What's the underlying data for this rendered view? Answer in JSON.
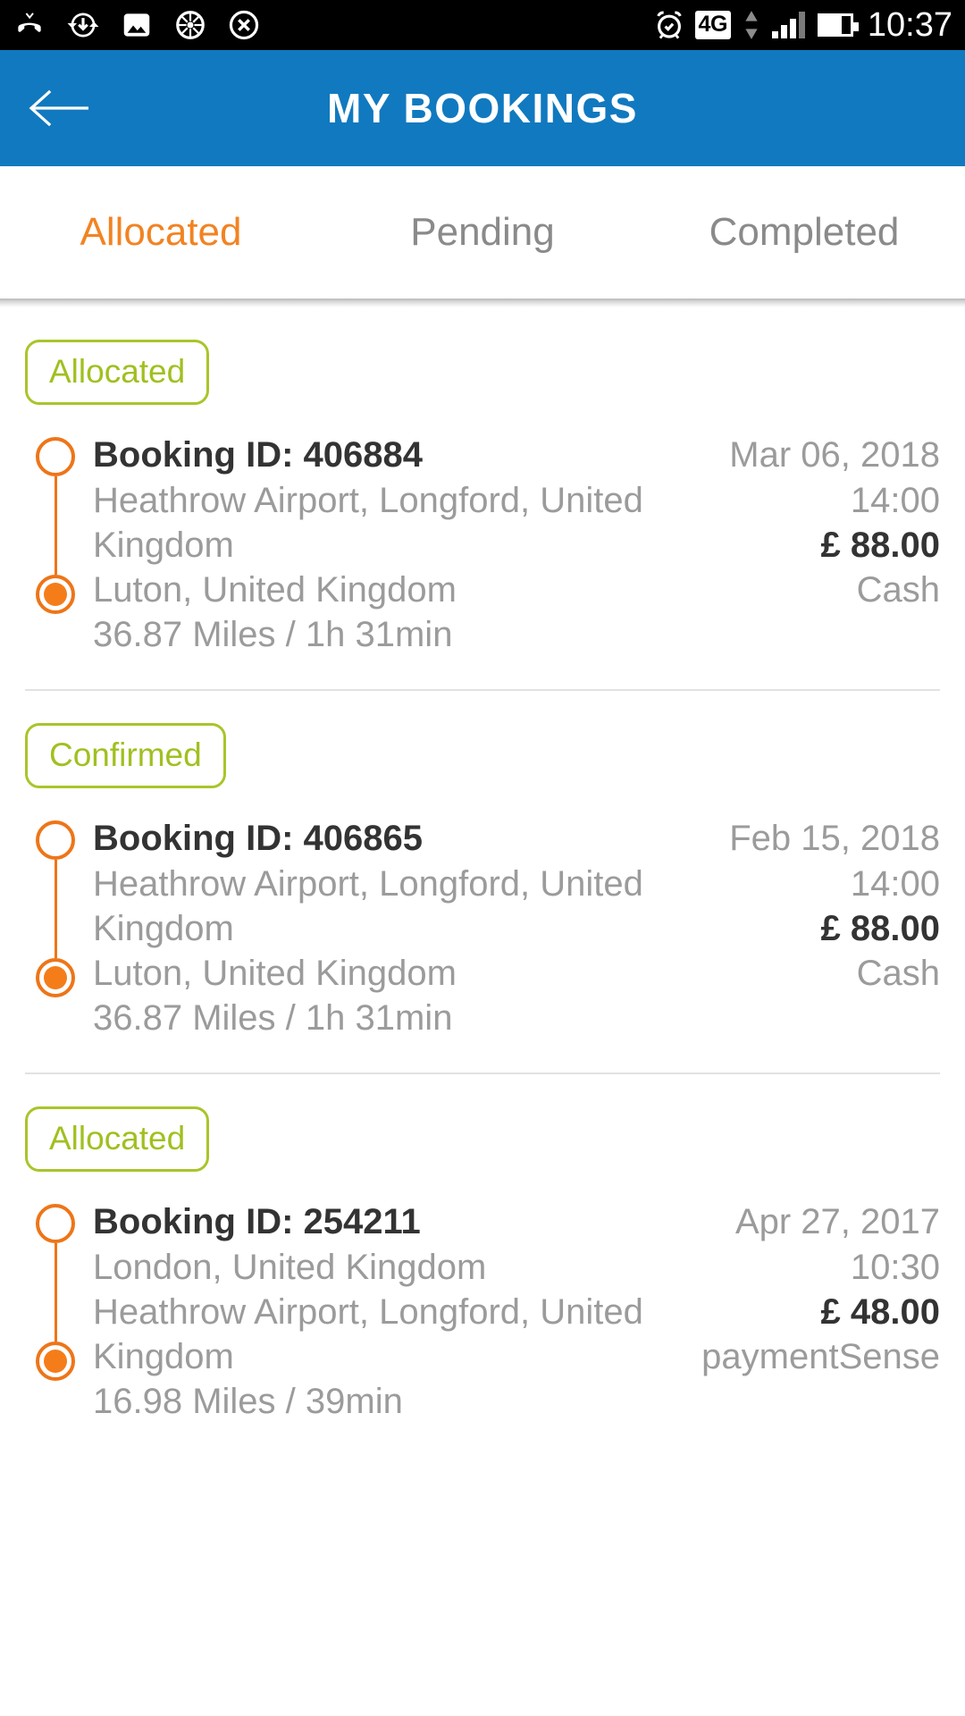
{
  "statusbar": {
    "time": "10:37",
    "network": "4G",
    "left_icons": [
      "missed-call-icon",
      "download-sync-icon",
      "image-icon",
      "wheel-icon",
      "close-circle-icon"
    ],
    "right_icons": [
      "alarm-clock-icon",
      "data-transfer-icon",
      "signal-bars-icon",
      "battery-icon"
    ]
  },
  "appbar": {
    "title": "MY BOOKINGS",
    "back_label": "back-arrow",
    "bg_color": "#1179bf"
  },
  "tabs": [
    {
      "label": "Allocated",
      "active": true
    },
    {
      "label": "Pending",
      "active": false
    },
    {
      "label": "Completed",
      "active": false
    }
  ],
  "colors": {
    "accent_orange": "#f28322",
    "badge_green": "#a0c020",
    "marker_orange": "#ee7518",
    "header_blue": "#1179bf",
    "muted_text": "#9b9b9b",
    "dark_text": "#333333"
  },
  "bookings": [
    {
      "status": "Allocated",
      "booking_id": "Booking ID: 406884",
      "pickup": "Heathrow Airport, Longford, United Kingdom",
      "dropoff": "Luton, United Kingdom",
      "distance_duration": "36.87 Miles / 1h 31min",
      "date": "Mar 06, 2018",
      "time": "14:00",
      "price": "£ 88.00",
      "payment_type": "Cash"
    },
    {
      "status": "Confirmed",
      "booking_id": "Booking ID: 406865",
      "pickup": "Heathrow Airport, Longford, United Kingdom",
      "dropoff": "Luton, United Kingdom",
      "distance_duration": "36.87 Miles / 1h 31min",
      "date": "Feb 15, 2018",
      "time": "14:00",
      "price": "£ 88.00",
      "payment_type": "Cash"
    },
    {
      "status": "Allocated",
      "booking_id": "Booking ID: 254211",
      "pickup": "London, United Kingdom",
      "dropoff": "Heathrow Airport, Longford, United Kingdom",
      "distance_duration": "16.98 Miles / 39min",
      "date": "Apr 27, 2017",
      "time": "10:30",
      "price": "£ 48.00",
      "payment_type": "paymentSense"
    }
  ]
}
